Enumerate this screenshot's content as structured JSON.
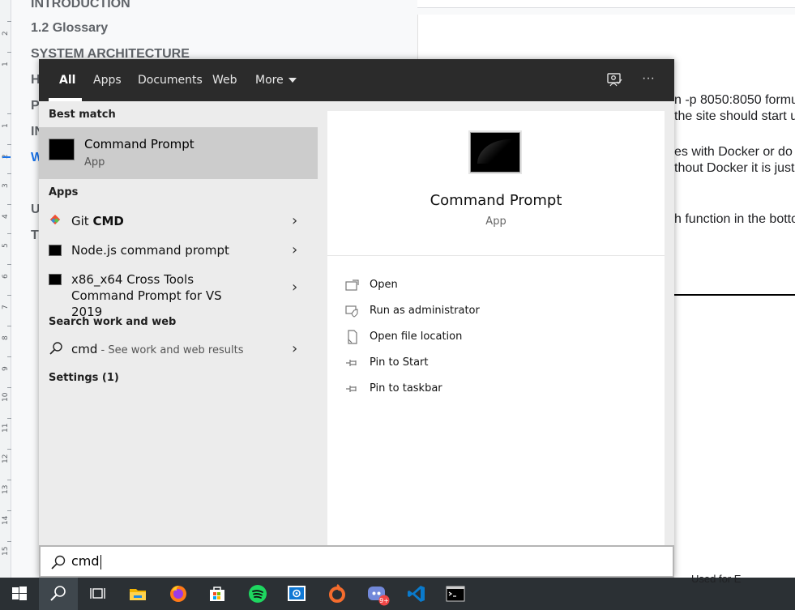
{
  "background_doc": {
    "outline": [
      {
        "label": "INTRODUCTION",
        "style": "bold"
      },
      {
        "label": "1.2 Glossary",
        "style": "bold"
      },
      {
        "label": "SYSTEM ARCHITECTURE",
        "style": "bold"
      },
      {
        "label": "H",
        "style": "bold"
      },
      {
        "label": "P",
        "style": "bold"
      },
      {
        "label": "IN",
        "style": "bold"
      },
      {
        "label": "W",
        "style": "active"
      },
      {
        "label": "U",
        "style": "bold"
      },
      {
        "label": "T",
        "style": "bold"
      }
    ],
    "ruler_numbers": [
      "2",
      "1",
      "1",
      "2",
      "3",
      "4",
      "5",
      "6",
      "7",
      "8",
      "9",
      "10",
      "11",
      "12",
      "13",
      "14",
      "15"
    ],
    "lines": [
      "n -p 8050:8050 formu",
      "the site should start u",
      "es with Docker or do n",
      "thout Docker it is just",
      "h function in the botto"
    ],
    "bottom_text": "Used for E"
  },
  "start_menu": {
    "tabs": [
      "All",
      "Apps",
      "Documents",
      "Web",
      "More"
    ],
    "selected_tab": "All",
    "top_icons": [
      "feedback-icon",
      "more-options-icon"
    ],
    "more_options_glyph": "···",
    "best_match": {
      "heading": "Best match",
      "name": "Command Prompt",
      "kind": "App"
    },
    "apps_heading": "Apps",
    "apps": [
      {
        "prefix": "Git ",
        "bold": "CMD",
        "icon": "git-icon"
      },
      {
        "prefix": "Node.js command prompt",
        "bold": "",
        "icon": "terminal-icon"
      },
      {
        "prefix": "x86_x64 Cross Tools Command Prompt for VS 2019",
        "bold": "",
        "icon": "terminal-icon"
      }
    ],
    "web_heading": "Search work and web",
    "web_query": "cmd",
    "web_hint": " - See work and web results",
    "settings_heading": "Settings (1)",
    "preview": {
      "title": "Command Prompt",
      "kind": "App",
      "actions": [
        {
          "label": "Open",
          "icon": "open-icon"
        },
        {
          "label": "Run as administrator",
          "icon": "shield-icon"
        },
        {
          "label": "Open file location",
          "icon": "file-location-icon"
        },
        {
          "label": "Pin to Start",
          "icon": "pin-icon"
        },
        {
          "label": "Pin to taskbar",
          "icon": "pin-icon"
        }
      ]
    },
    "search_value": "cmd"
  },
  "taskbar": {
    "items": [
      "windows-start-icon",
      "search-icon",
      "task-view-icon",
      "file-explorer-icon",
      "firefox-icon",
      "microsoft-store-icon",
      "spotify-icon",
      "remote-desktop-icon",
      "origin-icon",
      "discord-icon",
      "vscode-icon",
      "command-prompt-icon"
    ],
    "discord_badge": "9+"
  },
  "colors": {
    "topbar": "#2b2b2b",
    "menu_bg": "#ececec",
    "best_match_bg": "#cccccc",
    "taskbar_bg": "#2b3034",
    "accent_blue": "#1a73e8"
  }
}
